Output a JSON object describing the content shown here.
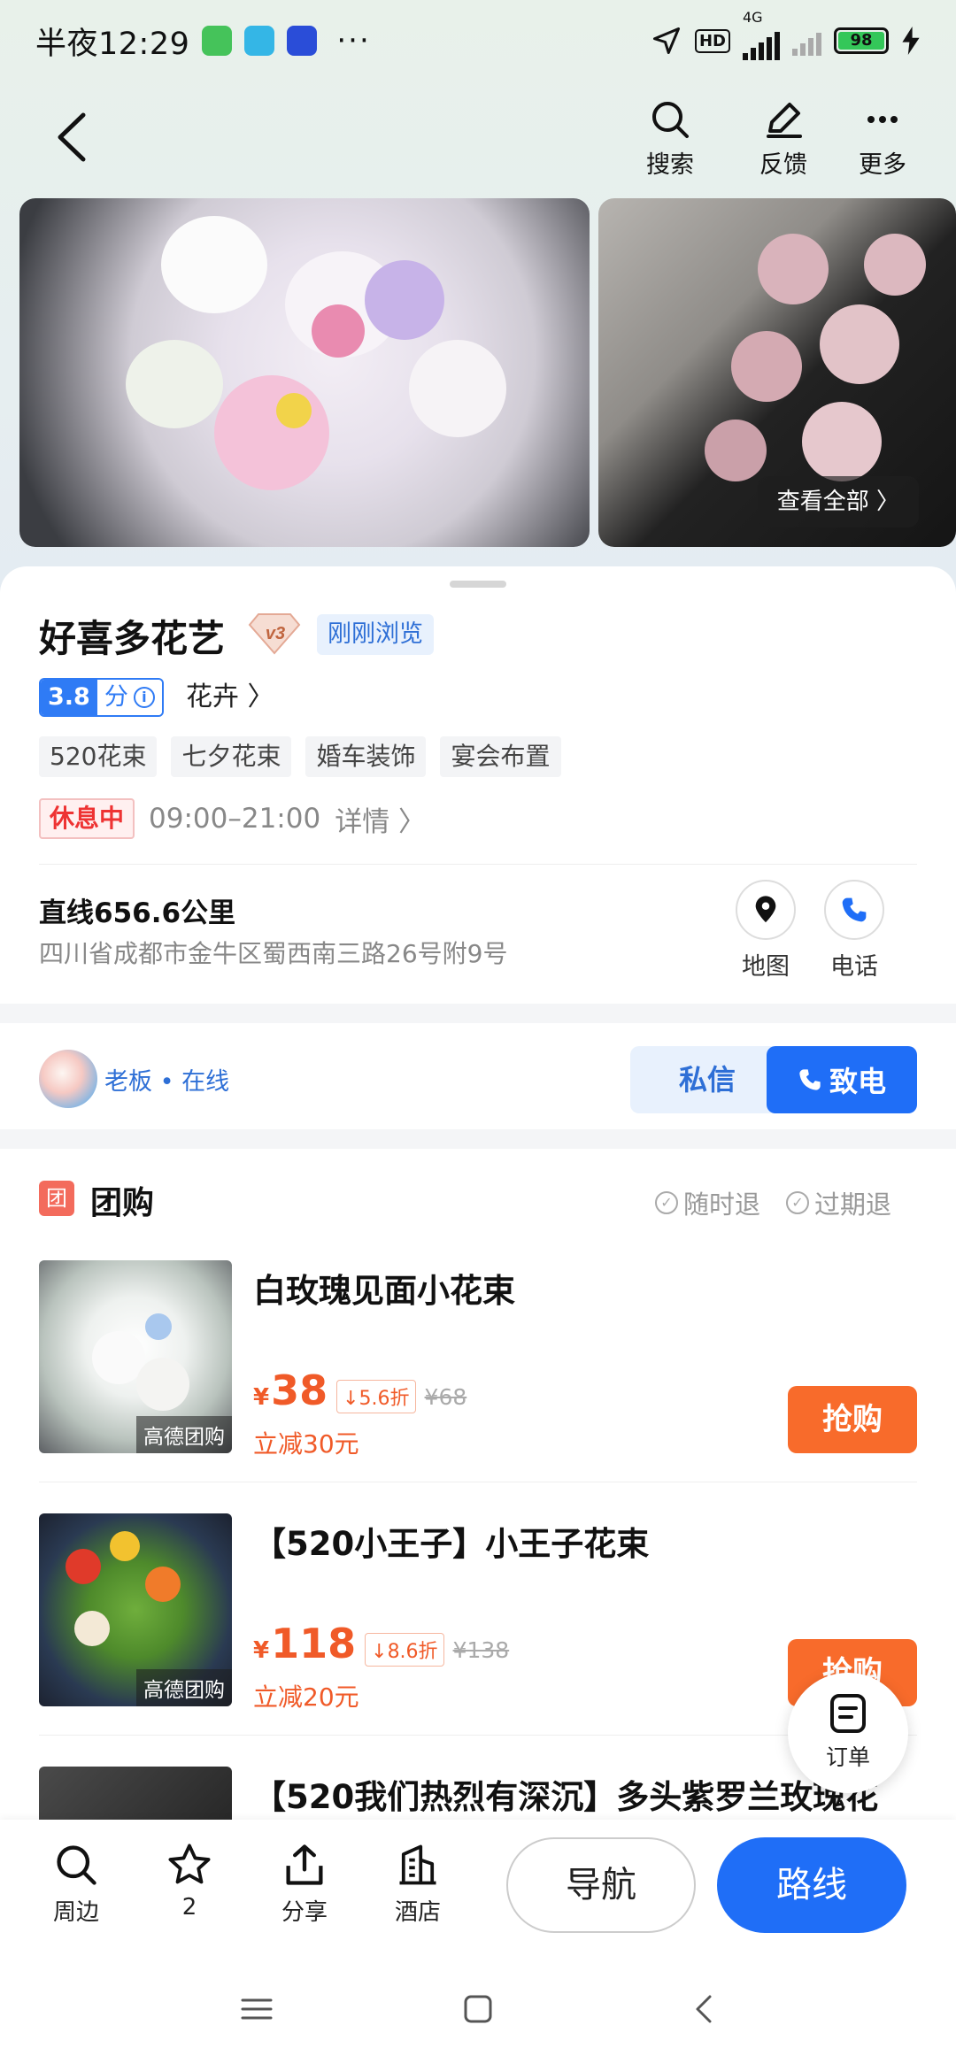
{
  "status_bar": {
    "time": "半夜12:29",
    "dots": "···",
    "network": "4G",
    "hd": "HD",
    "battery": "98"
  },
  "header": {
    "actions": [
      {
        "label": "搜索",
        "icon": "search-icon"
      },
      {
        "label": "反馈",
        "icon": "edit-icon"
      },
      {
        "label": "更多",
        "icon": "more-icon"
      }
    ]
  },
  "gallery": {
    "view_all": "查看全部 〉"
  },
  "shop": {
    "name": "好喜多花艺",
    "level_badge": "v3",
    "recent_tag": "刚刚浏览",
    "rating": "3.8",
    "rating_unit": "分",
    "info_glyph": "i",
    "category": "花卉 〉",
    "tags": [
      "520花束",
      "七夕花束",
      "婚车装饰",
      "宴会布置"
    ],
    "status": "休息中",
    "hours": "09:00–21:00",
    "details": "详情 〉",
    "distance": "直线656.6公里",
    "address": "四川省成都市金牛区蜀西南三路26号附9号",
    "map_label": "地图",
    "phone_label": "电话"
  },
  "owner": {
    "label": "老板 • 在线",
    "message_button": "私信",
    "call_button": "致电"
  },
  "group_buy": {
    "icon_text": "团",
    "title": "团购",
    "policy_1": "随时退",
    "policy_2": "过期退",
    "check": "✓",
    "deals": [
      {
        "title": "白玫瑰见面小花束",
        "yen": "¥",
        "price": "38",
        "discount": "5.6折",
        "original": "¥68",
        "save": "立减30元",
        "source": "高德团购",
        "button": "抢购"
      },
      {
        "title": "【520小王子】小王子花束",
        "yen": "¥",
        "price": "118",
        "discount": "8.6折",
        "original": "¥138",
        "save": "立减20元",
        "source": "高德团购",
        "button": "抢购"
      },
      {
        "title": "【520我们热烈有深沉】多头紫罗兰玫瑰花"
      }
    ]
  },
  "floating": {
    "order_label": "订单"
  },
  "bottom_bar": {
    "nearby": "周边",
    "favorites": "2",
    "share": "分享",
    "hotel": "酒店",
    "navigate": "导航",
    "route": "路线"
  }
}
